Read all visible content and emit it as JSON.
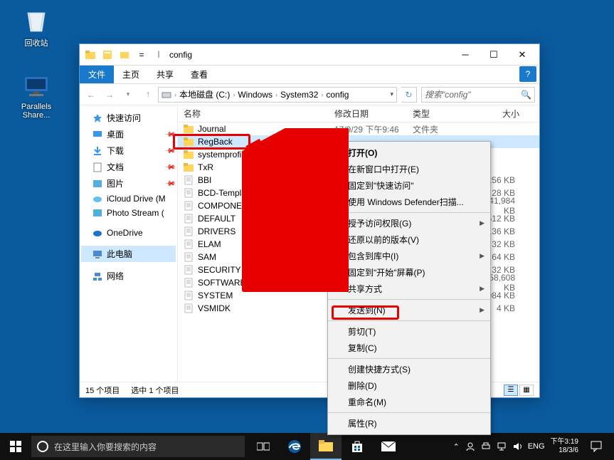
{
  "desktop_icons": {
    "recycle_bin": "回收站",
    "parallels": "Parallels Share..."
  },
  "window": {
    "title": "config",
    "tabs": {
      "file": "文件",
      "home": "主页",
      "share": "共享",
      "view": "查看"
    },
    "breadcrumb": {
      "root": "本地磁盘 (C:)",
      "p1": "Windows",
      "p2": "System32",
      "p3": "config"
    },
    "search_placeholder": "搜索\"config\"",
    "columns": {
      "name": "名称",
      "date": "修改日期",
      "type": "类型",
      "size": "大小"
    },
    "nav": {
      "quick_access": "快速访问",
      "desktop": "桌面",
      "downloads": "下载",
      "documents": "文档",
      "pictures": "图片",
      "icloud": "iCloud Drive (M",
      "photo_stream": "Photo Stream (",
      "onedrive": "OneDrive",
      "this_pc": "此电脑",
      "network": "网络"
    },
    "files": [
      {
        "name": "Journal",
        "folder": true,
        "date": "17/9/29 下午9:46",
        "type": "文件夹",
        "size": ""
      },
      {
        "name": "RegBack",
        "folder": true,
        "date": "",
        "type": "",
        "size": "",
        "selected": true
      },
      {
        "name": "systemprofile",
        "folder": true,
        "date": "",
        "type": "",
        "size": ""
      },
      {
        "name": "TxR",
        "folder": true,
        "date": "",
        "type": "",
        "size": ""
      },
      {
        "name": "BBI",
        "folder": false,
        "date": "",
        "type": "",
        "size": "256 KB"
      },
      {
        "name": "BCD-Template",
        "folder": false,
        "date": "",
        "type": "",
        "size": "28 KB"
      },
      {
        "name": "COMPONENTS",
        "folder": false,
        "date": "",
        "type": "",
        "size": "41,984 KB"
      },
      {
        "name": "DEFAULT",
        "folder": false,
        "date": "",
        "type": "",
        "size": "512 KB"
      },
      {
        "name": "DRIVERS",
        "folder": false,
        "date": "",
        "type": "",
        "size": "5,136 KB"
      },
      {
        "name": "ELAM",
        "folder": false,
        "date": "",
        "type": "",
        "size": "32 KB"
      },
      {
        "name": "SAM",
        "folder": false,
        "date": "",
        "type": "",
        "size": "64 KB"
      },
      {
        "name": "SECURITY",
        "folder": false,
        "date": "",
        "type": "",
        "size": "32 KB"
      },
      {
        "name": "SOFTWARE",
        "folder": false,
        "date": "",
        "type": "",
        "size": "58,608 KB"
      },
      {
        "name": "SYSTEM",
        "folder": false,
        "date": "",
        "type": "",
        "size": "9,984 KB"
      },
      {
        "name": "VSMIDK",
        "folder": false,
        "date": "",
        "type": "",
        "size": "4 KB"
      }
    ],
    "status": {
      "count": "15 个项目",
      "selected": "选中 1 个项目"
    }
  },
  "context_menu": {
    "open": "打开(O)",
    "open_new_window": "在新窗口中打开(E)",
    "pin_quick_access": "固定到\"快速访问\"",
    "defender_scan": "使用 Windows Defender扫描...",
    "grant_access": "授予访问权限(G)",
    "restore_previous": "还原以前的版本(V)",
    "include_in_library": "包含到库中(I)",
    "pin_to_start": "固定到\"开始\"屏幕(P)",
    "share": "共享方式",
    "send_to": "发送到(N)",
    "cut": "剪切(T)",
    "copy": "复制(C)",
    "create_shortcut": "创建快捷方式(S)",
    "delete": "删除(D)",
    "rename": "重命名(M)",
    "properties": "属性(R)"
  },
  "taskbar": {
    "cortana_placeholder": "在这里输入你要搜索的内容",
    "ime": "ENG",
    "clock_time": "下午3:19",
    "clock_date": "18/3/6"
  }
}
